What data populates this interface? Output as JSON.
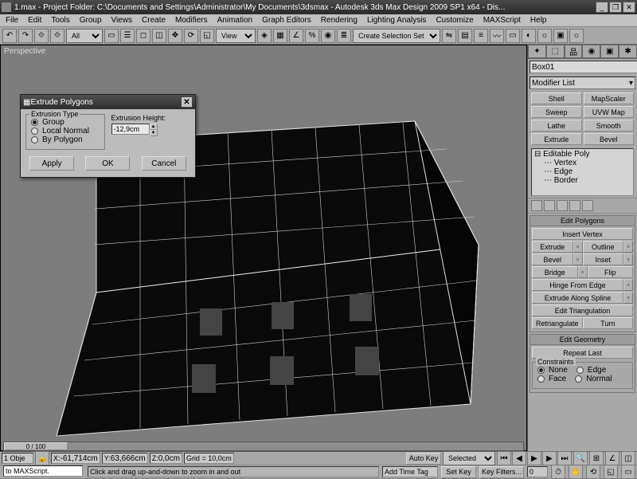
{
  "window": {
    "title": "1.max   - Project Folder: C:\\Documents and Settings\\Administrator\\My Documents\\3dsmax  - Autodesk 3ds Max Design 2009 SP1  x64   - Dis..."
  },
  "menu": [
    "File",
    "Edit",
    "Tools",
    "Group",
    "Views",
    "Create",
    "Modifiers",
    "Animation",
    "Graph Editors",
    "Rendering",
    "Lighting Analysis",
    "Customize",
    "MAXScript",
    "Help"
  ],
  "toolbar": {
    "filter": "All",
    "view": "View",
    "selectionSet": "Create Selection Set"
  },
  "viewport": {
    "label": "Perspective"
  },
  "panel": {
    "objectName": "Box01",
    "modListLabel": "Modifier List",
    "modButtons": [
      "Shell",
      "MapScaler",
      "Sweep",
      "UVW Map",
      "Lathe",
      "Smooth",
      "Extrude",
      "Bevel"
    ],
    "stack": [
      "Editable Poly",
      "Vertex",
      "Edge",
      "Border"
    ],
    "editPolys": {
      "title": "Edit Polygons",
      "insertVertex": "Insert Vertex",
      "extrude": "Extrude",
      "outline": "Outline",
      "bevel": "Bevel",
      "inset": "Inset",
      "bridge": "Bridge",
      "flip": "Flip",
      "hinge": "Hinge From Edge",
      "extrudeSpline": "Extrude Along Spline",
      "editTri": "Edit Triangulation",
      "retri": "Retriangulate",
      "turn": "Turn"
    },
    "editGeom": {
      "title": "Edit Geometry",
      "repeat": "Repeat Last",
      "constraintsLabel": "Constraints",
      "none": "None",
      "edge": "Edge",
      "face": "Face",
      "normal": "Normal"
    }
  },
  "dialog": {
    "title": "Extrude Polygons",
    "groupLabel": "Extrusion Type",
    "optGroup": "Group",
    "optLocal": "Local Normal",
    "optPoly": "By Polygon",
    "heightLabel": "Extrusion Height:",
    "heightValue": "-12,9cm",
    "apply": "Apply",
    "ok": "OK",
    "cancel": "Cancel"
  },
  "status": {
    "slider": "0 / 100",
    "objCount": "1 Obje",
    "x": "-61,714cm",
    "y": "63,666cm",
    "z": "0,0cm",
    "grid": "Grid = 10,0cm",
    "autoKey": "Auto Key",
    "setKey": "Set Key",
    "selected": "Selected",
    "addTimeTag": "Add Time Tag",
    "keyFilters": "Key Filters...",
    "hint": "Click and drag up-and-down to zoom in and out",
    "maxscript": "to MAXScript."
  }
}
